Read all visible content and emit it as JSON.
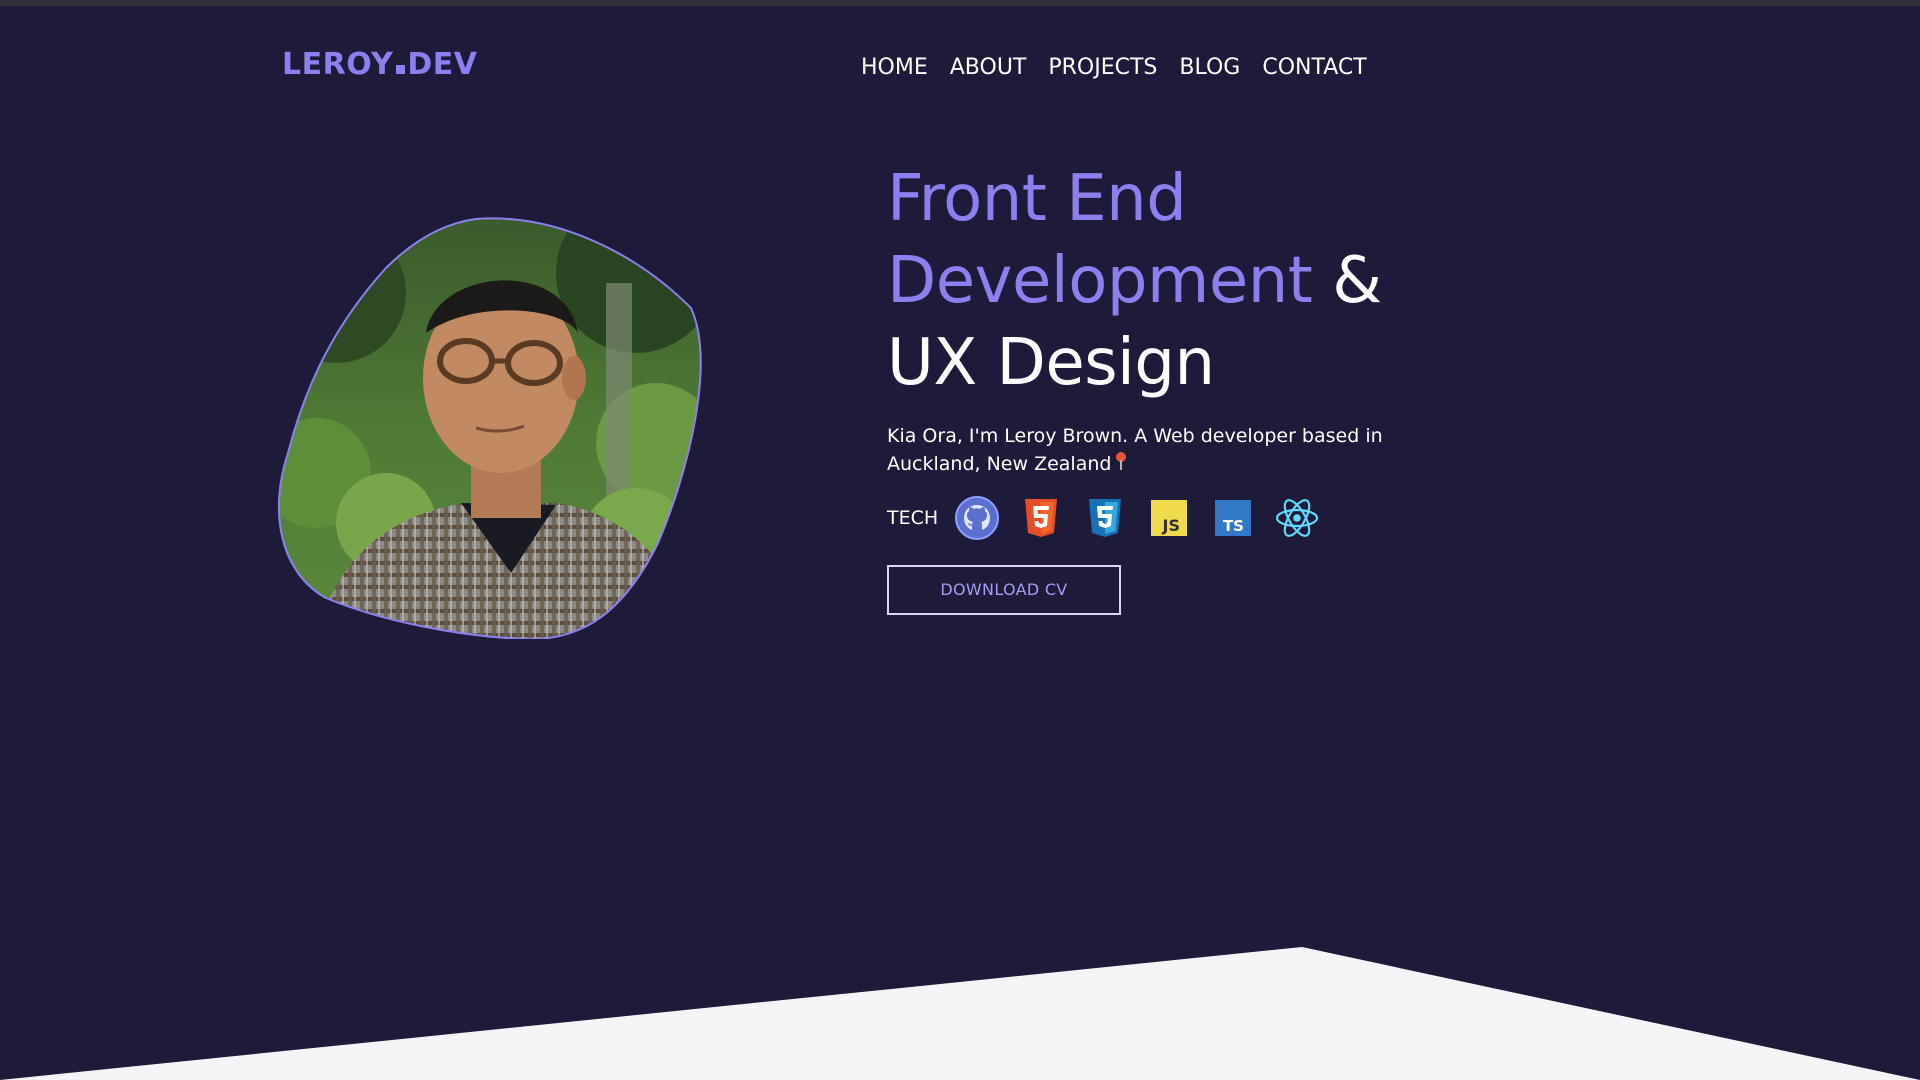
{
  "brand": {
    "logo_left": "LEROY",
    "logo_right": "DEV"
  },
  "nav": {
    "items": [
      "HOME",
      "ABOUT",
      "PROJECTS",
      "BLOG",
      "CONTACT"
    ]
  },
  "hero": {
    "headline_accent_1": "Front End",
    "headline_accent_2": "Development",
    "headline_amp": "&",
    "headline_plain": "UX Design",
    "intro": "Kia Ora, I'm Leroy Brown. A Web developer based in Auckland, New Zealand",
    "tech_label": "TECH",
    "tech_icons": [
      "github-icon",
      "html5-icon",
      "css3-icon",
      "javascript-icon",
      "typescript-icon",
      "react-icon"
    ],
    "download_label": "DOWNLOAD CV"
  },
  "colors": {
    "background": "#1d1a3a",
    "accent": "#8b80ee",
    "bottom_panel": "#f4f4f7"
  }
}
